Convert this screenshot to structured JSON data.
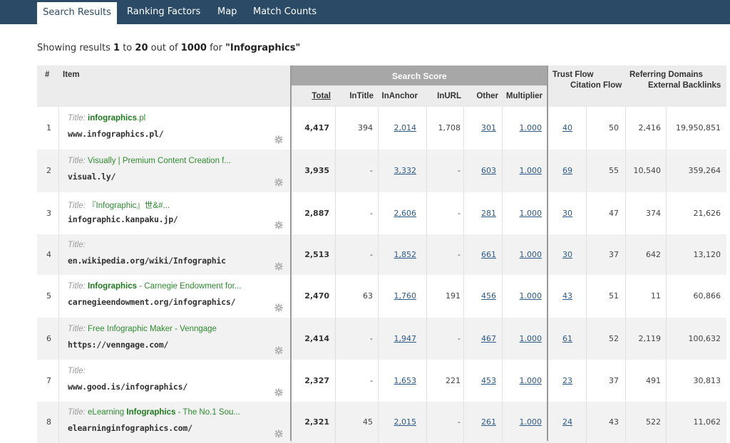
{
  "tabs": [
    {
      "label": "Search Results",
      "active": true
    },
    {
      "label": "Ranking Factors",
      "active": false
    },
    {
      "label": "Map",
      "active": false
    },
    {
      "label": "Match Counts",
      "active": false
    }
  ],
  "summary": {
    "prefix": "Showing results",
    "from": "1",
    "to_word": "to",
    "to": "20",
    "out_of": "out of",
    "total": "1000",
    "for_word": "for",
    "query": "\"Infographics\""
  },
  "headers": {
    "num": "#",
    "item": "Item",
    "search_score": "Search Score",
    "total": "Total",
    "intitle": "InTitle",
    "inanchor": "InAnchor",
    "inurl": "InURL",
    "other": "Other",
    "multiplier": "Multiplier",
    "trust_flow": "Trust Flow",
    "citation_flow": "Citation Flow",
    "referring_domains": "Referring Domains",
    "external_backlinks": "External Backlinks"
  },
  "title_label": "Title:",
  "rows": [
    {
      "n": "1",
      "title_pre": "",
      "title_hl": "infographics",
      "title_post": ".pl",
      "url": "www.infographics.pl/",
      "total": "4,417",
      "intitle": "394",
      "inanchor": "2,014",
      "inurl": "1,708",
      "other": "301",
      "multiplier": "1.000",
      "tf": "40",
      "cf": "50",
      "rd": "2,416",
      "eb": "19,950,851"
    },
    {
      "n": "2",
      "title_pre": "Visually | Premium Content Creation f...",
      "title_hl": "",
      "title_post": "",
      "url": "visual.ly/",
      "total": "3,935",
      "intitle": "-",
      "inanchor": "3,332",
      "inurl": "-",
      "other": "603",
      "multiplier": "1.000",
      "tf": "69",
      "cf": "55",
      "rd": "10,540",
      "eb": "359,264"
    },
    {
      "n": "3",
      "title_pre": "『Infographic』世&#...",
      "title_hl": "",
      "title_post": "",
      "url": "infographic.kanpaku.jp/",
      "total": "2,887",
      "intitle": "-",
      "inanchor": "2,606",
      "inurl": "-",
      "other": "281",
      "multiplier": "1.000",
      "tf": "30",
      "cf": "47",
      "rd": "374",
      "eb": "21,626"
    },
    {
      "n": "4",
      "title_pre": "",
      "title_hl": "",
      "title_post": "",
      "url": "en.wikipedia.org/wiki/Infographic",
      "total": "2,513",
      "intitle": "-",
      "inanchor": "1,852",
      "inurl": "-",
      "other": "661",
      "multiplier": "1.000",
      "tf": "30",
      "cf": "37",
      "rd": "642",
      "eb": "13,120"
    },
    {
      "n": "5",
      "title_pre": "",
      "title_hl": "Infographics",
      "title_post": " - Carnegie Endowment for...",
      "url": "carnegieendowment.org/infographics/",
      "total": "2,470",
      "intitle": "63",
      "inanchor": "1,760",
      "inurl": "191",
      "other": "456",
      "multiplier": "1.000",
      "tf": "43",
      "cf": "51",
      "rd": "11",
      "eb": "60,866"
    },
    {
      "n": "6",
      "title_pre": "Free Infographic Maker - Venngage",
      "title_hl": "",
      "title_post": "",
      "url": "https://venngage.com/",
      "total": "2,414",
      "intitle": "-",
      "inanchor": "1,947",
      "inurl": "-",
      "other": "467",
      "multiplier": "1.000",
      "tf": "61",
      "cf": "52",
      "rd": "2,119",
      "eb": "100,632"
    },
    {
      "n": "7",
      "title_pre": "",
      "title_hl": "",
      "title_post": "",
      "url": "www.good.is/infographics/",
      "total": "2,327",
      "intitle": "-",
      "inanchor": "1,653",
      "inurl": "221",
      "other": "453",
      "multiplier": "1.000",
      "tf": "23",
      "cf": "37",
      "rd": "491",
      "eb": "30,813"
    },
    {
      "n": "8",
      "title_pre": "eLearning ",
      "title_hl": "Infographics",
      "title_post": " - The No.1 Sou...",
      "url": "elearninginfographics.com/",
      "total": "2,321",
      "intitle": "45",
      "inanchor": "2,015",
      "inurl": "-",
      "other": "261",
      "multiplier": "1.000",
      "tf": "24",
      "cf": "43",
      "rd": "522",
      "eb": "11,062"
    }
  ],
  "colors": {
    "nav_bg": "#2a4a66",
    "score_header_bg": "#a7a7a7",
    "title_green": "#2e8b2e",
    "link_blue": "#2b5a8a"
  },
  "icons": {
    "settings": "gear-icon"
  }
}
